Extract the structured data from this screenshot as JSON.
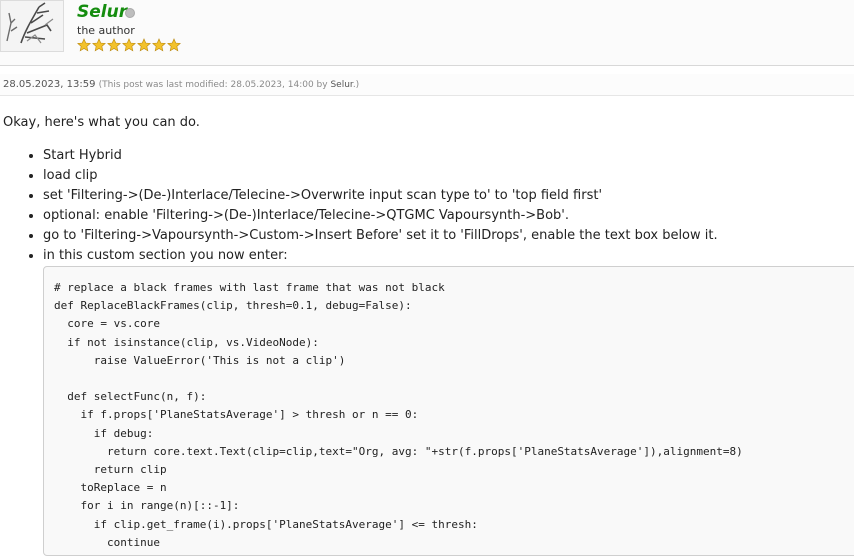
{
  "author": {
    "name": "Selur",
    "title": "the author",
    "status": "offline",
    "rank_stars": 7,
    "name_color": "#158d0f",
    "star_color": "#f3c22b"
  },
  "post": {
    "date": "28.05.2023, 13:59",
    "modified_prefix": "(This post was last modified: 28.05.2023, 14:00 by ",
    "modified_by": "Selur",
    "modified_suffix": ".)",
    "intro": "Okay, here's what you can do.",
    "steps": [
      "Start Hybrid",
      "load clip",
      "set 'Filtering->(De-)Interlace/Telecine->Overwrite input scan type to' to 'top field first'",
      "optional: enable 'Filtering->(De-)Interlace/Telecine->QTGMC Vapoursynth->Bob'.",
      "go to 'Filtering->Vapoursynth->Custom->Insert Before' set it to 'FillDrops', enable the text box below it.",
      "in this custom section you now enter:"
    ],
    "code": "# replace a black frames with last frame that was not black\ndef ReplaceBlackFrames(clip, thresh=0.1, debug=False):\n  core = vs.core\n  if not isinstance(clip, vs.VideoNode):\n      raise ValueError('This is not a clip')\n\n  def selectFunc(n, f):\n    if f.props['PlaneStatsAverage'] > thresh or n == 0:\n      if debug:\n        return core.text.Text(clip=clip,text=\"Org, avg: \"+str(f.props['PlaneStatsAverage']),alignment=8)\n      return clip\n    toReplace = n\n    for i in range(n)[::-1]:\n      if clip.get_frame(i).props['PlaneStatsAverage'] <= thresh:\n        continue"
  }
}
